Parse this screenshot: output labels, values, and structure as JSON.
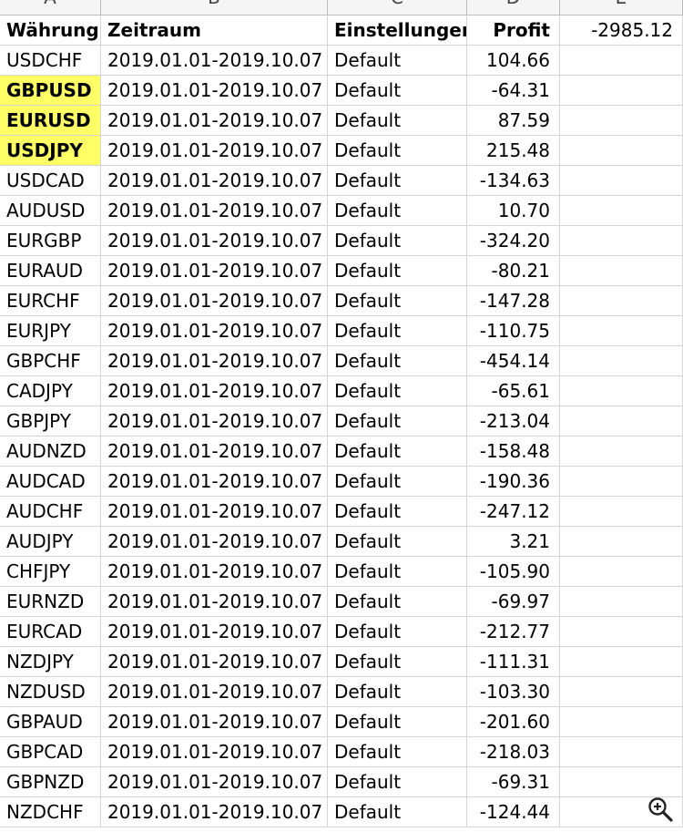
{
  "columns": [
    "A",
    "B",
    "C",
    "D",
    "E"
  ],
  "header": {
    "currency": "Währung",
    "period": "Zeitraum",
    "settings": "Einstellungen",
    "profit": "Profit",
    "total": "-2985.12"
  },
  "highlight_color": "#ffff66",
  "rows": [
    {
      "currency": "USDCHF",
      "period": "2019.01.01-2019.10.07",
      "settings": "Default",
      "profit": "104.66",
      "highlight": false
    },
    {
      "currency": "GBPUSD",
      "period": "2019.01.01-2019.10.07",
      "settings": "Default",
      "profit": "-64.31",
      "highlight": true
    },
    {
      "currency": "EURUSD",
      "period": "2019.01.01-2019.10.07",
      "settings": "Default",
      "profit": "87.59",
      "highlight": true
    },
    {
      "currency": "USDJPY",
      "period": "2019.01.01-2019.10.07",
      "settings": "Default",
      "profit": "215.48",
      "highlight": true
    },
    {
      "currency": "USDCAD",
      "period": "2019.01.01-2019.10.07",
      "settings": "Default",
      "profit": "-134.63",
      "highlight": false
    },
    {
      "currency": "AUDUSD",
      "period": "2019.01.01-2019.10.07",
      "settings": "Default",
      "profit": "10.70",
      "highlight": false
    },
    {
      "currency": "EURGBP",
      "period": "2019.01.01-2019.10.07",
      "settings": "Default",
      "profit": "-324.20",
      "highlight": false
    },
    {
      "currency": "EURAUD",
      "period": "2019.01.01-2019.10.07",
      "settings": "Default",
      "profit": "-80.21",
      "highlight": false
    },
    {
      "currency": "EURCHF",
      "period": "2019.01.01-2019.10.07",
      "settings": "Default",
      "profit": "-147.28",
      "highlight": false
    },
    {
      "currency": "EURJPY",
      "period": "2019.01.01-2019.10.07",
      "settings": "Default",
      "profit": "-110.75",
      "highlight": false
    },
    {
      "currency": "GBPCHF",
      "period": "2019.01.01-2019.10.07",
      "settings": "Default",
      "profit": "-454.14",
      "highlight": false
    },
    {
      "currency": "CADJPY",
      "period": "2019.01.01-2019.10.07",
      "settings": "Default",
      "profit": "-65.61",
      "highlight": false
    },
    {
      "currency": "GBPJPY",
      "period": "2019.01.01-2019.10.07",
      "settings": "Default",
      "profit": "-213.04",
      "highlight": false
    },
    {
      "currency": "AUDNZD",
      "period": "2019.01.01-2019.10.07",
      "settings": "Default",
      "profit": "-158.48",
      "highlight": false
    },
    {
      "currency": "AUDCAD",
      "period": "2019.01.01-2019.10.07",
      "settings": "Default",
      "profit": "-190.36",
      "highlight": false
    },
    {
      "currency": "AUDCHF",
      "period": "2019.01.01-2019.10.07",
      "settings": "Default",
      "profit": "-247.12",
      "highlight": false
    },
    {
      "currency": "AUDJPY",
      "period": "2019.01.01-2019.10.07",
      "settings": "Default",
      "profit": "3.21",
      "highlight": false
    },
    {
      "currency": "CHFJPY",
      "period": "2019.01.01-2019.10.07",
      "settings": "Default",
      "profit": "-105.90",
      "highlight": false
    },
    {
      "currency": "EURNZD",
      "period": "2019.01.01-2019.10.07",
      "settings": "Default",
      "profit": "-69.97",
      "highlight": false
    },
    {
      "currency": "EURCAD",
      "period": "2019.01.01-2019.10.07",
      "settings": "Default",
      "profit": "-212.77",
      "highlight": false
    },
    {
      "currency": "NZDJPY",
      "period": "2019.01.01-2019.10.07",
      "settings": "Default",
      "profit": "-111.31",
      "highlight": false
    },
    {
      "currency": "NZDUSD",
      "period": "2019.01.01-2019.10.07",
      "settings": "Default",
      "profit": "-103.30",
      "highlight": false
    },
    {
      "currency": "GBPAUD",
      "period": "2019.01.01-2019.10.07",
      "settings": "Default",
      "profit": "-201.60",
      "highlight": false
    },
    {
      "currency": "GBPCAD",
      "period": "2019.01.01-2019.10.07",
      "settings": "Default",
      "profit": "-218.03",
      "highlight": false
    },
    {
      "currency": "GBPNZD",
      "period": "2019.01.01-2019.10.07",
      "settings": "Default",
      "profit": "-69.31",
      "highlight": false
    },
    {
      "currency": "NZDCHF",
      "period": "2019.01.01-2019.10.07",
      "settings": "Default",
      "profit": "-124.44",
      "highlight": false
    }
  ],
  "icons": {
    "zoom": "zoom-in-icon"
  }
}
